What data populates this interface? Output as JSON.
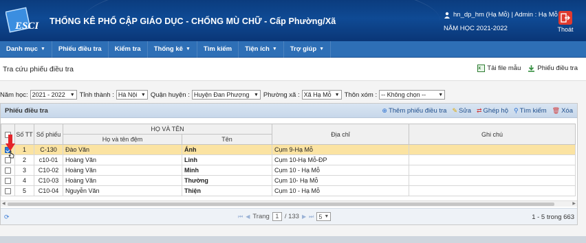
{
  "header": {
    "logo_text": "ESCI",
    "title": "THỐNG KÊ PHỔ CẬP GIÁO DỤC - CHỐNG MÙ CHỮ - Cấp Phường/Xã",
    "user": "hn_dp_hm (Hạ Mỗ) | Admin : Hạ Mỗ",
    "year": "NĂM HỌC 2021-2022",
    "logout": "Thoát"
  },
  "nav": {
    "items": [
      {
        "label": "Danh mục",
        "caret": true
      },
      {
        "label": "Phiếu điều tra",
        "caret": false
      },
      {
        "label": "Kiểm tra",
        "caret": false
      },
      {
        "label": "Thống kê",
        "caret": true
      },
      {
        "label": "Tìm kiếm",
        "caret": false
      },
      {
        "label": "Tiện ích",
        "caret": true
      },
      {
        "label": "Trợ giúp",
        "caret": true
      }
    ]
  },
  "page": {
    "title": "Tra cứu phiếu điều tra",
    "download_template": "Tải file mẫu",
    "download_forms": "Phiếu điều tra"
  },
  "filters": {
    "year_label": "Năm học:",
    "year_value": "2021 - 2022",
    "province_label": "Tỉnh thành :",
    "province_value": "Hà Nội",
    "district_label": "Quận huyện :",
    "district_value": "Huyện Đan Phượng",
    "ward_label": "Phường xã :",
    "ward_value": "Xã Hạ Mỗ",
    "hamlet_label": "Thôn xóm :",
    "hamlet_value": "-- Không chọn --"
  },
  "panel": {
    "title": "Phiếu điều tra",
    "tools": {
      "add": "Thêm phiếu điều tra",
      "edit": "Sửa",
      "merge": "Ghép hộ",
      "search": "Tìm kiếm",
      "delete": "Xóa"
    }
  },
  "grid": {
    "headers": {
      "stt": "Số TT",
      "so_phieu": "Số phiếu",
      "ho_va_ten": "HỌ VÀ TÊN",
      "ho_dem": "Họ và tên đệm",
      "ten": "Tên",
      "dia_chi": "Địa chỉ",
      "ghi_chu": "Ghi chú"
    },
    "rows": [
      {
        "stt": "1",
        "so_phieu": "C-130",
        "ho_dem": "Đào Văn",
        "ten": "Ánh",
        "dia_chi": "Cụm 9-Hạ Mỗ",
        "ghi_chu": "",
        "checked": true,
        "selected": true
      },
      {
        "stt": "2",
        "so_phieu": "c10-01",
        "ho_dem": "Hoàng Văn",
        "ten": "Linh",
        "dia_chi": "Cụm 10-Hạ Mỗ-ĐP",
        "ghi_chu": "",
        "checked": false,
        "selected": false
      },
      {
        "stt": "3",
        "so_phieu": "C10-02",
        "ho_dem": "Hoàng Văn",
        "ten": "Minh",
        "dia_chi": "Cụm 10 - Hạ Mỗ",
        "ghi_chu": "",
        "checked": false,
        "selected": false
      },
      {
        "stt": "4",
        "so_phieu": "C10-03",
        "ho_dem": "Hoàng Văn",
        "ten": "Thường",
        "dia_chi": "Cụm 10- Hạ Mỗ",
        "ghi_chu": "",
        "checked": false,
        "selected": false
      },
      {
        "stt": "5",
        "so_phieu": "C10-04",
        "ho_dem": "Nguyễn Văn",
        "ten": "Thiện",
        "dia_chi": "Cụm 10 - Hạ Mỗ",
        "ghi_chu": "",
        "checked": false,
        "selected": false
      }
    ]
  },
  "pager": {
    "page_label": "Trang",
    "page_value": "1",
    "total_pages": "/ 133",
    "page_size": "5",
    "info": "1 - 5 trong 663"
  },
  "colors": {
    "header_bg": "#0f4a94",
    "nav_bg": "#2e6fb6",
    "selected_row": "#fbe3a2",
    "arrow": "#e3252b"
  }
}
